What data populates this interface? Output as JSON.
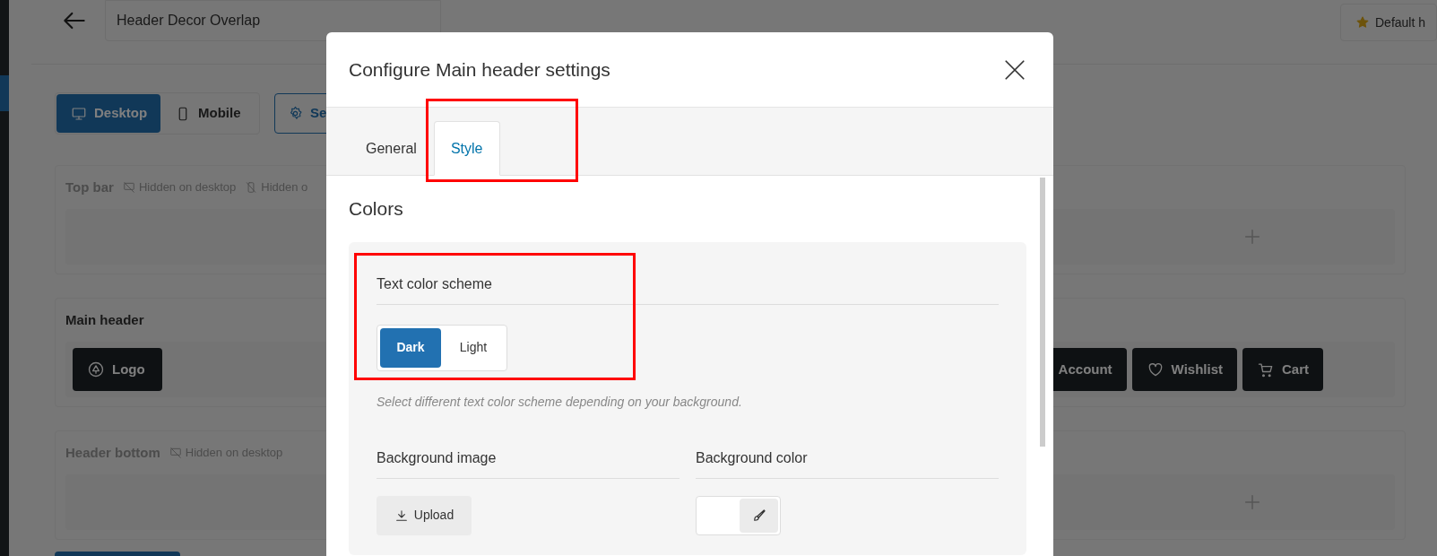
{
  "editor": {
    "title": "Header Decor Overlap",
    "badge": "Default h",
    "view_tabs": [
      {
        "label": "Desktop",
        "selected": true
      },
      {
        "label": "Mobile",
        "selected": false
      }
    ],
    "settings_button": "Se",
    "sections": [
      {
        "title": "Top bar",
        "hidden": true,
        "flags": [
          "Hidden on desktop",
          "Hidden o"
        ]
      },
      {
        "title": "Main header",
        "hidden": false,
        "left_items": [
          {
            "kind": "logo",
            "label": "Logo"
          }
        ],
        "right_items": [
          {
            "kind": "account",
            "label": "Account"
          },
          {
            "kind": "wishlist",
            "label": "Wishlist"
          },
          {
            "kind": "cart",
            "label": "Cart"
          }
        ]
      },
      {
        "title": "Header bottom",
        "hidden": true,
        "flags": [
          "Hidden on desktop"
        ]
      }
    ]
  },
  "modal": {
    "title": "Configure Main header settings",
    "tabs": [
      {
        "label": "General",
        "selected": false
      },
      {
        "label": "Style",
        "selected": true
      }
    ],
    "heading": "Colors",
    "text_color_scheme": {
      "label": "Text color scheme",
      "options": [
        {
          "label": "Dark",
          "selected": true
        },
        {
          "label": "Light",
          "selected": false
        }
      ],
      "help": "Select different text color scheme depending on your background."
    },
    "background_image": {
      "label": "Background image",
      "button": "Upload"
    },
    "background_color": {
      "label": "Background color"
    }
  }
}
